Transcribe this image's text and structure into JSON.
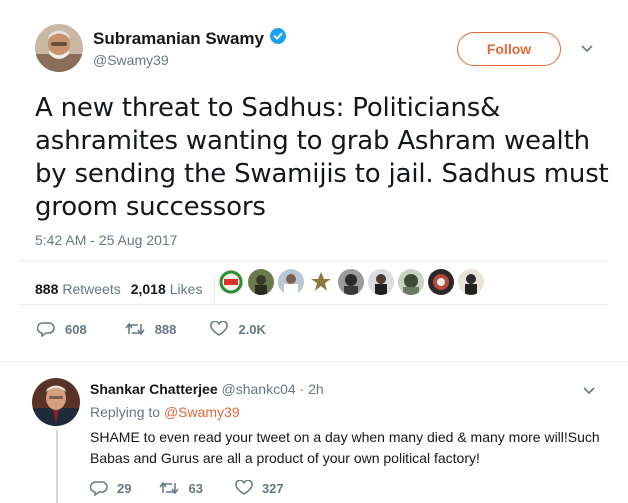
{
  "tweet": {
    "display_name": "Subramanian Swamy",
    "handle": "@Swamy39",
    "follow_label": "Follow",
    "text": "A new threat to Sadhus: Politicians& ashramites wanting to grab Ashram wealth by sending the Swamijis to jail. Sadhus must groom successors",
    "timestamp": "5:42 AM - 25 Aug 2017",
    "retweets_count": "888",
    "retweets_label": "Retweets",
    "likes_count": "2,018",
    "likes_label": "Likes",
    "reply_count": "608",
    "retweet_action_count": "888",
    "like_action_count": "2.0K",
    "accent_color": "#e0693a",
    "verified_color": "#1da1f2"
  },
  "reply": {
    "display_name": "Shankar Chatterjee",
    "handle": "@shankc04",
    "separator": "·",
    "age": "2h",
    "replying_prefix": "Replying to",
    "replying_to": "@Swamy39",
    "text": "SHAME to even read your tweet on a day when many died & many more will!Such Babas and Gurus are all a product of your own political factory!",
    "reply_count": "29",
    "retweet_count": "63",
    "like_count": "327"
  }
}
